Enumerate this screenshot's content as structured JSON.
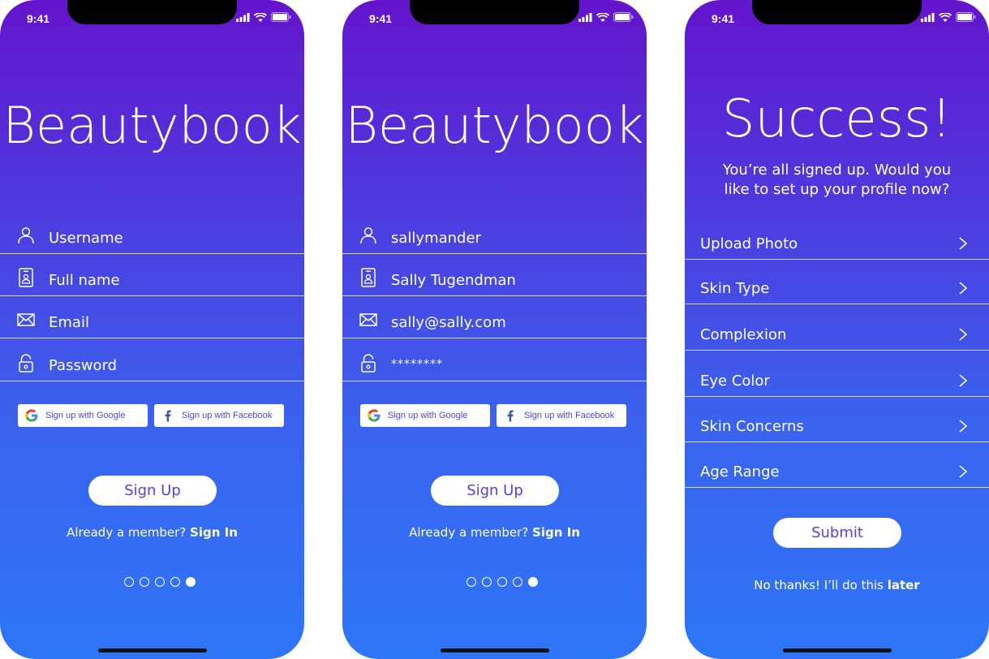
{
  "colors": {
    "gradient_top": "#6414cc",
    "gradient_bottom": "#2d76f8",
    "accent_text": "#5a3fd6"
  },
  "status": {
    "time": "9:41"
  },
  "screen1": {
    "brand": "Beautybook",
    "fields": [
      {
        "icon": "user-icon",
        "text": "Username"
      },
      {
        "icon": "id-card-icon",
        "text": "Full name"
      },
      {
        "icon": "mail-icon",
        "text": "Email"
      },
      {
        "icon": "lock-icon",
        "text": "Password"
      }
    ],
    "google_label": "Sign up with Google",
    "facebook_label": "Sign up with Facebook",
    "signup_label": "Sign Up",
    "member_prefix": "Already a member? ",
    "member_link": "Sign In",
    "pager": {
      "count": 5,
      "active": 5
    }
  },
  "screen2": {
    "brand": "Beautybook",
    "fields": [
      {
        "icon": "user-icon",
        "text": "sallymander"
      },
      {
        "icon": "id-card-icon",
        "text": "Sally Tugendman"
      },
      {
        "icon": "mail-icon",
        "text": "sally@sally.com"
      },
      {
        "icon": "lock-icon",
        "text": "********"
      }
    ],
    "google_label": "Sign up with Google",
    "facebook_label": "Sign up with Facebook",
    "signup_label": "Sign Up",
    "member_prefix": "Already a member? ",
    "member_link": "Sign In",
    "pager": {
      "count": 5,
      "active": 5
    }
  },
  "screen3": {
    "title": "Success!",
    "subtitle": "You’re all signed up. Would you like to set up your profile now?",
    "rows": [
      {
        "label": "Upload Photo"
      },
      {
        "label": "Skin Type"
      },
      {
        "label": "Complexion"
      },
      {
        "label": "Eye Color"
      },
      {
        "label": "Skin Concerns"
      },
      {
        "label": "Age Range"
      }
    ],
    "submit_label": "Submit",
    "later_prefix": "No thanks! I’ll do this ",
    "later_link": "later"
  }
}
